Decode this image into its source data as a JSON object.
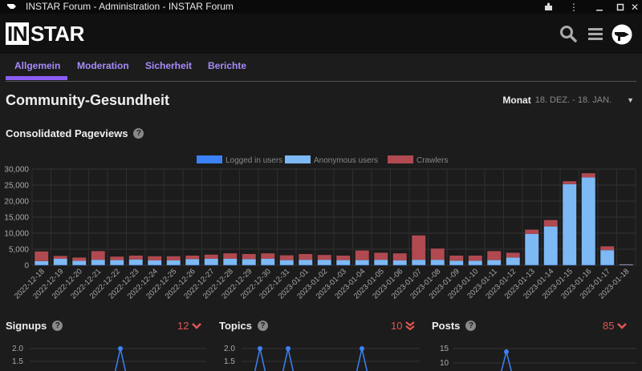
{
  "window": {
    "title": "INSTAR Forum - Administration - INSTAR Forum"
  },
  "logo": {
    "part1": "IN",
    "part2": "STAR"
  },
  "tabs": [
    {
      "label": "Allgemein",
      "active": true
    },
    {
      "label": "Moderation",
      "active": false
    },
    {
      "label": "Sicherheit",
      "active": false
    },
    {
      "label": "Berichte",
      "active": false
    }
  ],
  "page": {
    "title": "Community-Gesundheit",
    "period_label": "Monat",
    "period_range": "18. DEZ. - 18. JAN."
  },
  "pageviews": {
    "title": "Consolidated Pageviews"
  },
  "chart_data": {
    "type": "bar",
    "stacked": true,
    "categories": [
      "2022-12-18",
      "2022-12-19",
      "2022-12-20",
      "2022-12-21",
      "2022-12-22",
      "2022-12-23",
      "2022-12-24",
      "2022-12-25",
      "2022-12-26",
      "2022-12-27",
      "2022-12-28",
      "2022-12-29",
      "2022-12-30",
      "2022-12-31",
      "2023-01-01",
      "2023-01-02",
      "2023-01-03",
      "2023-01-04",
      "2023-01-05",
      "2023-01-06",
      "2023-01-07",
      "2023-01-08",
      "2023-01-09",
      "2023-01-10",
      "2023-01-11",
      "2023-01-12",
      "2023-01-13",
      "2023-01-14",
      "2023-01-15",
      "2023-01-16",
      "2023-01-17",
      "2023-01-18"
    ],
    "series": [
      {
        "name": "Logged in users",
        "color": "#3b82f6",
        "values": [
          100,
          100,
          100,
          100,
          100,
          100,
          100,
          100,
          100,
          100,
          100,
          100,
          100,
          100,
          100,
          100,
          100,
          100,
          100,
          100,
          100,
          100,
          100,
          100,
          100,
          100,
          100,
          100,
          100,
          100,
          100,
          0
        ]
      },
      {
        "name": "Anonymous users",
        "color": "#7db9f5",
        "values": [
          1200,
          1900,
          1300,
          1600,
          1500,
          1700,
          1400,
          1400,
          1800,
          1900,
          1900,
          1800,
          1900,
          1500,
          1600,
          1600,
          1500,
          1500,
          1600,
          1400,
          1600,
          1600,
          1300,
          1300,
          1500,
          2300,
          9700,
          12000,
          25200,
          27300,
          4600,
          200
        ]
      },
      {
        "name": "Crawlers",
        "color": "#b04a50",
        "values": [
          3000,
          900,
          1000,
          2700,
          1100,
          1200,
          1300,
          1300,
          1100,
          1300,
          1700,
          1600,
          1700,
          1500,
          1800,
          1500,
          1400,
          3000,
          2200,
          2200,
          7600,
          3500,
          1600,
          1600,
          2800,
          1500,
          1300,
          2000,
          900,
          1300,
          1200,
          100
        ]
      }
    ],
    "ylim": [
      0,
      30000
    ],
    "yticks": [
      "0",
      "5,000",
      "10,000",
      "15,000",
      "20,000",
      "25,000",
      "30,000"
    ],
    "legend_position": "top-center",
    "grid": true
  },
  "stats": [
    {
      "title": "Signups",
      "value": "12",
      "trend": "down",
      "mini_ticks": [
        "2.0",
        "1.5"
      ]
    },
    {
      "title": "Topics",
      "value": "10",
      "trend": "double-down",
      "mini_ticks": [
        "2.0",
        "1.5"
      ]
    },
    {
      "title": "Posts",
      "value": "85",
      "trend": "down",
      "mini_ticks": [
        "15",
        "10"
      ]
    }
  ]
}
